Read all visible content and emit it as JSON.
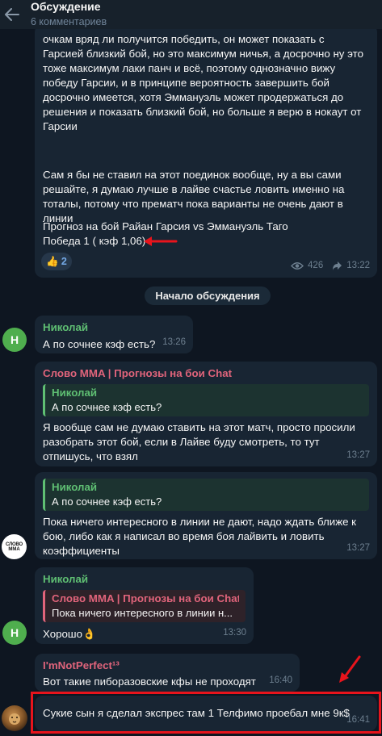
{
  "header": {
    "title": "Обсуждение",
    "subtitle": "6 комментариев"
  },
  "post": {
    "paragraph1": "очкам вряд ли получится победить, он может показать с Гарсией близкий бой, но это максимум ничья, а досрочно ну это тоже максимум лаки панч и всё, поэтому однозначно вижу победу Гарсии, и в принципе вероятность завершить бой досрочно имеется, хотя Эммануэль может продержаться до решения и показать близкий бой, но больше я верю в нокаут от Гарсии",
    "paragraph2": "Сам я бы не ставил на этот поединок вообще, ну а вы сами решайте, я думаю лучше в лайве счастье ловить именно на тоталы, потому что прематч пока варианты не очень дают в линии",
    "forecast_title": "Прогноз на бой Райан Гарсия vs Эммануэль Таго",
    "forecast_pick": "Победа 1 ( кэф 1,06)",
    "reaction_emoji": "👍",
    "reaction_count": "2",
    "views": "426",
    "time": "13:22"
  },
  "system_message": "Начало обсуждения",
  "messages": [
    {
      "sender": "Николай",
      "text": "А по сочнее кэф есть?",
      "time": "13:26",
      "avatar_letter": "Н"
    },
    {
      "sender": "Слово MMA | Прогнозы на бои Chat",
      "reply_sender": "Николай",
      "reply_text": "А по сочнее кэф есть?",
      "text": "Я вообще сам не думаю ставить на этот матч, просто просили разобрать этот бой, если в Лайве буду смотреть, то тут отпишусь, что взял",
      "time": "13:27"
    },
    {
      "reply_sender": "Николай",
      "reply_text": "А по сочнее кэф есть?",
      "text": "Пока ничего интересного в линии не дают, надо ждать ближе к бою, либо как я написал во время боя лайвить и ловить коэффициенты",
      "time": "13:27",
      "avatar_text": "СЛОВО\nMMA"
    },
    {
      "sender": "Николай",
      "reply_sender": "Слово MMA | Прогнозы на бои Chat",
      "reply_text": "Пока ничего интересного в линии н...",
      "text": "Хорошо👌",
      "time": "13:30",
      "avatar_letter": "Н"
    },
    {
      "sender": "I'mNotPerfect¹³",
      "text": "Вот такие пиборазовские кфы не проходят",
      "time": "16:40"
    },
    {
      "text": "Сукие сын я сделал экспрес там 1 Телфимо проебал мне 9к$",
      "time": "16:41"
    }
  ],
  "colors": {
    "background": "#0e1621",
    "bubble": "#182533",
    "green_name": "#5fbf73",
    "pink_name": "#e0647b",
    "annotation_red": "#e8141c"
  }
}
